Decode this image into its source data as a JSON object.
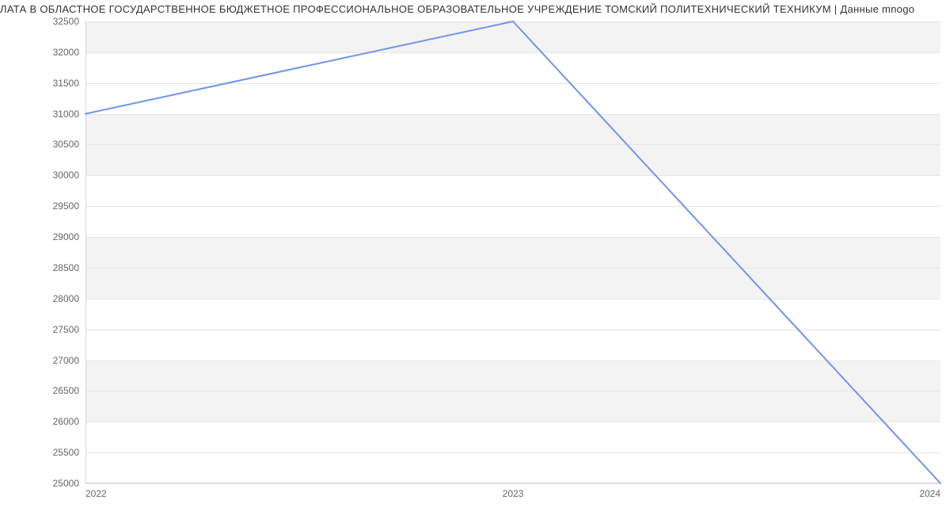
{
  "title": "ЛАТА В ОБЛАСТНОЕ ГОСУДАРСТВЕННОЕ БЮДЖЕТНОЕ ПРОФЕССИОНАЛЬНОЕ ОБРАЗОВАТЕЛЬНОЕ УЧРЕЖДЕНИЕ ТОМСКИЙ ПОЛИТЕХНИЧЕСКИЙ ТЕХНИКУМ | Данные mnogo",
  "y_ticks": [
    "25000",
    "25500",
    "26000",
    "26500",
    "27000",
    "27500",
    "28000",
    "28500",
    "29000",
    "29500",
    "30000",
    "30500",
    "31000",
    "31500",
    "32000",
    "32500"
  ],
  "x_ticks": [
    "2022",
    "2023",
    "2024"
  ],
  "chart_data": {
    "type": "line",
    "title": "ЛАТА В ОБЛАСТНОЕ ГОСУДАРСТВЕННОЕ БЮДЖЕТНОЕ ПРОФЕССИОНАЛЬНОЕ ОБРАЗОВАТЕЛЬНОЕ УЧРЕЖДЕНИЕ ТОМСКИЙ ПОЛИТЕХНИЧЕСКИЙ ТЕХНИКУМ | Данные mnogo",
    "xlabel": "",
    "ylabel": "",
    "x": [
      "2022",
      "2023",
      "2024"
    ],
    "values": [
      31000,
      32500,
      25000
    ],
    "ylim": [
      25000,
      32500
    ],
    "line_color": "#6f94e9"
  }
}
